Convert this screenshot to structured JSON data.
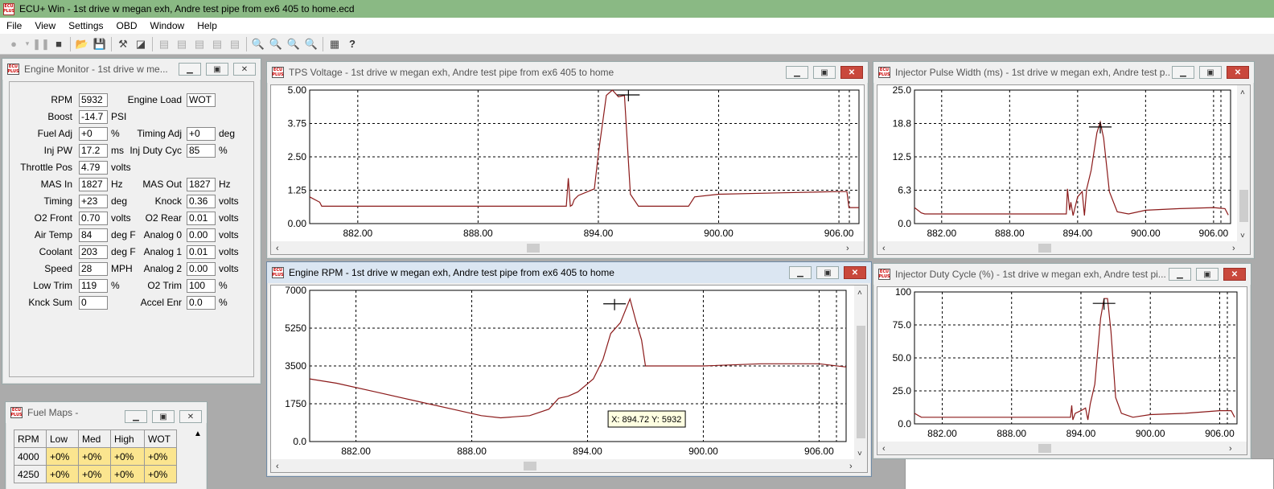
{
  "app": {
    "title": "ECU+ Win - 1st drive w megan exh, Andre test pipe from ex6 405 to home.ecd",
    "icon_text_top": "ECU",
    "icon_text_bottom": "PLUS"
  },
  "menu": [
    "File",
    "View",
    "Settings",
    "OBD",
    "Window",
    "Help"
  ],
  "toolbar_icons": [
    "record-icon",
    "dropdown-icon",
    "pause-icon",
    "stop-icon",
    "open-icon",
    "save-icon",
    "hammer-icon",
    "graph-select-icon",
    "window1-icon",
    "window2-icon",
    "window3-icon",
    "window4-icon",
    "window5-icon",
    "zoom-out-icon",
    "zoom-in-icon",
    "zoom-x-icon",
    "zoom-y-icon",
    "chart-icon",
    "help-icon"
  ],
  "engine_monitor": {
    "title": "Engine Monitor - 1st drive w me...",
    "left": [
      {
        "label": "RPM",
        "value": "5932",
        "unit": ""
      },
      {
        "label": "Boost",
        "value": "-14.7",
        "unit": "PSI"
      },
      {
        "label": "Fuel Adj",
        "value": "+0",
        "unit": "%"
      },
      {
        "label": "Inj PW",
        "value": "17.2",
        "unit": "ms"
      },
      {
        "label": "Throttle Pos",
        "value": "4.79",
        "unit": "volts"
      },
      {
        "label": "MAS In",
        "value": "1827",
        "unit": "Hz"
      },
      {
        "label": "Timing",
        "value": "+23",
        "unit": "deg"
      },
      {
        "label": "O2 Front",
        "value": "0.70",
        "unit": "volts"
      },
      {
        "label": "Air Temp",
        "value": "84",
        "unit": "deg F"
      },
      {
        "label": "Coolant",
        "value": "203",
        "unit": "deg F"
      },
      {
        "label": "Speed",
        "value": "28",
        "unit": "MPH"
      },
      {
        "label": "Low Trim",
        "value": "119",
        "unit": "%"
      },
      {
        "label": "Knck Sum",
        "value": "0",
        "unit": ""
      }
    ],
    "right": [
      {
        "label": "Engine Load",
        "value": "WOT",
        "unit": ""
      },
      {
        "label": "",
        "value": "",
        "unit": ""
      },
      {
        "label": "Timing Adj",
        "value": "+0",
        "unit": "deg"
      },
      {
        "label": "Inj Duty Cyc",
        "value": "85",
        "unit": "%"
      },
      {
        "label": "",
        "value": "",
        "unit": ""
      },
      {
        "label": "MAS Out",
        "value": "1827",
        "unit": "Hz"
      },
      {
        "label": "Knock",
        "value": "0.36",
        "unit": "volts"
      },
      {
        "label": "O2 Rear",
        "value": "0.01",
        "unit": "volts"
      },
      {
        "label": "Analog 0",
        "value": "0.00",
        "unit": "volts"
      },
      {
        "label": "Analog 1",
        "value": "0.01",
        "unit": "volts"
      },
      {
        "label": "Analog 2",
        "value": "0.00",
        "unit": "volts"
      },
      {
        "label": "O2 Trim",
        "value": "100",
        "unit": "%"
      },
      {
        "label": "Accel Enr",
        "value": "0.0",
        "unit": "%"
      }
    ]
  },
  "fuel_maps": {
    "title": "Fuel Maps -",
    "headers": [
      "RPM",
      "Low",
      "Med",
      "High",
      "WOT"
    ],
    "rows": [
      [
        "4000",
        "+0%",
        "+0%",
        "+0%",
        "+0%"
      ],
      [
        "4250",
        "+0%",
        "+0%",
        "+0%",
        "+0%"
      ]
    ]
  },
  "chart_data": [
    {
      "id": "tps",
      "type": "line",
      "title": "TPS Voltage - 1st drive w megan exh, Andre test pipe from ex6 405 to home",
      "xlabel": "",
      "ylabel": "",
      "xlim": [
        879.6,
        907.0
      ],
      "ylim": [
        0,
        5
      ],
      "yticks": [
        "5.00",
        "3.75",
        "2.50",
        "1.25",
        "0.00"
      ],
      "xticks": [
        "882.00",
        "888.00",
        "894.00",
        "900.00",
        "906.00"
      ],
      "xtick_values": [
        882,
        888,
        894,
        900,
        906
      ],
      "cursor_x": 895.5,
      "grid": true,
      "color": "#8b1a1a",
      "series": [
        {
          "x": [
            879.6,
            880.1,
            880.2,
            882,
            885,
            888,
            891,
            892.4,
            892.5,
            892.6,
            892.7,
            892.8,
            893,
            893.8,
            894.0,
            894.4,
            894.7,
            895.0,
            895.3,
            895.6,
            896.0,
            897.0,
            898.5,
            898.8,
            900,
            903,
            906,
            906.4,
            906.5,
            907.0
          ],
          "y": [
            1.0,
            0.8,
            0.65,
            0.65,
            0.65,
            0.65,
            0.65,
            0.65,
            1.7,
            0.65,
            0.7,
            0.9,
            1.05,
            1.3,
            2.6,
            4.8,
            5.0,
            4.75,
            4.8,
            1.1,
            0.65,
            0.65,
            0.65,
            1.0,
            1.1,
            1.15,
            1.2,
            1.2,
            0.6,
            0.6
          ]
        }
      ]
    },
    {
      "id": "ipw",
      "type": "line",
      "title": "Injector Pulse Width (ms) - 1st drive w megan exh, Andre test p...",
      "xlabel": "",
      "ylabel": "",
      "xlim": [
        879.6,
        907.5
      ],
      "ylim": [
        0,
        25
      ],
      "yticks": [
        "25.0",
        "18.8",
        "12.5",
        "6.3",
        "0.0"
      ],
      "xticks": [
        "882.00",
        "888.00",
        "894.00",
        "900.00",
        "906.00"
      ],
      "xtick_values": [
        882,
        888,
        894,
        900,
        906
      ],
      "cursor_x": 896.0,
      "grid": true,
      "color": "#8b1a1a",
      "series": [
        {
          "x": [
            879.6,
            880.2,
            880.5,
            884,
            888,
            891,
            893.0,
            893.1,
            893.3,
            893.4,
            893.6,
            894.0,
            894.4,
            894.6,
            894.8,
            895.2,
            895.7,
            896.0,
            896.3,
            896.8,
            897.5,
            898.5,
            900,
            903,
            906,
            907,
            907.3
          ],
          "y": [
            3.0,
            2.0,
            1.8,
            1.8,
            1.8,
            1.8,
            1.8,
            6.5,
            2.5,
            4.0,
            1.5,
            5.0,
            6.0,
            1.5,
            6.5,
            10.0,
            17.0,
            19.0,
            16.0,
            6.0,
            2.2,
            1.8,
            2.5,
            2.8,
            3.0,
            2.8,
            1.6
          ]
        }
      ]
    },
    {
      "id": "rpm",
      "type": "line",
      "title": "Engine RPM - 1st drive w megan exh, Andre test pipe from ex6 405 to home",
      "xlabel": "",
      "ylabel": "",
      "xlim": [
        879.6,
        907.4
      ],
      "ylim": [
        0,
        7000
      ],
      "yticks": [
        "7000",
        "5250",
        "3500",
        "1750",
        "0.0"
      ],
      "xticks": [
        "882.00",
        "888.00",
        "894.00",
        "900.00",
        "906.00"
      ],
      "xtick_values": [
        882,
        888,
        894,
        900,
        906
      ],
      "cursor_x": 895.4,
      "grid": true,
      "tooltip": "X: 894.72  Y: 5932",
      "color": "#8b1a1a",
      "series": [
        {
          "x": [
            879.6,
            881,
            883,
            885,
            887,
            888.5,
            889.5,
            891,
            892,
            892.5,
            893,
            893.5,
            894.3,
            894.8,
            895.2,
            895.7,
            896.2,
            896.5,
            896.8,
            897.0,
            898,
            900,
            903,
            906,
            907.4
          ],
          "y": [
            2900,
            2700,
            2300,
            1900,
            1500,
            1200,
            1100,
            1200,
            1500,
            2000,
            2100,
            2300,
            2900,
            3800,
            5000,
            5500,
            6600,
            5600,
            4700,
            3500,
            3500,
            3500,
            3600,
            3600,
            3450
          ]
        }
      ]
    },
    {
      "id": "idc",
      "type": "line",
      "title": "Injector Duty Cycle (%) - 1st drive w megan exh, Andre test pi...",
      "xlabel": "",
      "ylabel": "",
      "xlim": [
        879.6,
        907.5
      ],
      "ylim": [
        0,
        100
      ],
      "yticks": [
        "100",
        "75.0",
        "50.0",
        "25.0",
        "0.0"
      ],
      "xticks": [
        "882.00",
        "888.00",
        "894.00",
        "900.00",
        "906.00"
      ],
      "xtick_values": [
        882,
        888,
        894,
        900,
        906
      ],
      "cursor_x": 896.0,
      "grid": true,
      "color": "#8b1a1a",
      "series": [
        {
          "x": [
            879.6,
            880.2,
            880.5,
            884,
            888,
            891,
            893.1,
            893.2,
            893.3,
            893.5,
            894.0,
            894.4,
            894.6,
            894.8,
            895.2,
            895.7,
            896.0,
            896.3,
            896.6,
            897.0,
            897.5,
            898.5,
            900,
            903,
            906,
            907,
            907.3
          ],
          "y": [
            8,
            5,
            5,
            5,
            5,
            5,
            5,
            14,
            3,
            8,
            10,
            12,
            3,
            15,
            30,
            80,
            95,
            95,
            70,
            20,
            8,
            5,
            7,
            8,
            10,
            10,
            5
          ]
        }
      ]
    }
  ]
}
